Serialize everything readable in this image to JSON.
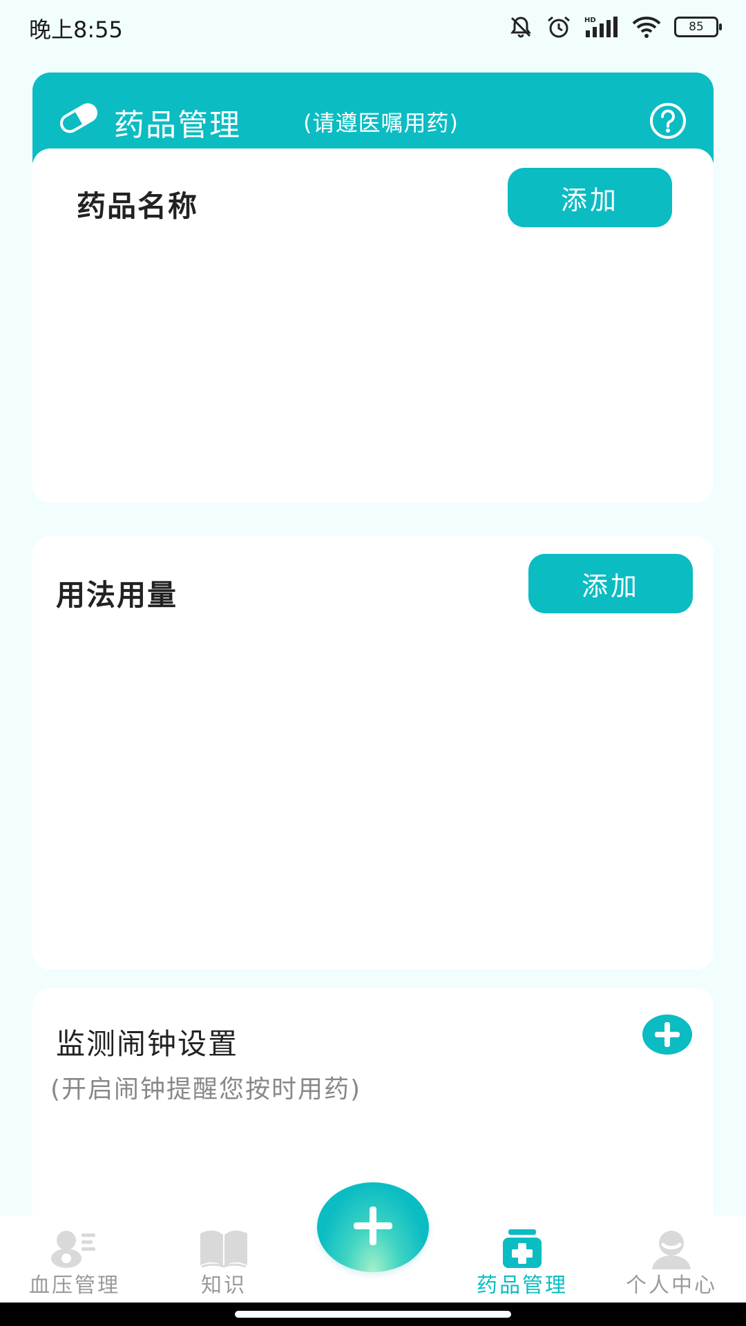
{
  "status_bar": {
    "time": "晚上8:55",
    "signal_label": "HD",
    "battery": "85"
  },
  "header": {
    "title": "药品管理",
    "subtitle": "(请遵医嘱用药)",
    "help_icon": "question-circle-icon",
    "brand_color": "#0bbcc3"
  },
  "medicine_card": {
    "title": "药品名称",
    "add_label": "添加"
  },
  "dosage_card": {
    "title": "用法用量",
    "add_label": "添加"
  },
  "alarm_card": {
    "title": "监测闹钟设置",
    "subtitle": "(开启闹钟提醒您按时用药)",
    "add_icon": "plus-circle-icon"
  },
  "bottom_nav": {
    "items": [
      {
        "label": "血压管理",
        "icon": "blood-pressure-icon",
        "active": false
      },
      {
        "label": "知识",
        "icon": "book-icon",
        "active": false
      },
      {
        "label": "药品管理",
        "icon": "medicine-kit-icon",
        "active": true
      },
      {
        "label": "个人中心",
        "icon": "profile-icon",
        "active": false
      }
    ],
    "fab_icon": "plus-icon",
    "inactive_color": "#9a9a9a"
  }
}
